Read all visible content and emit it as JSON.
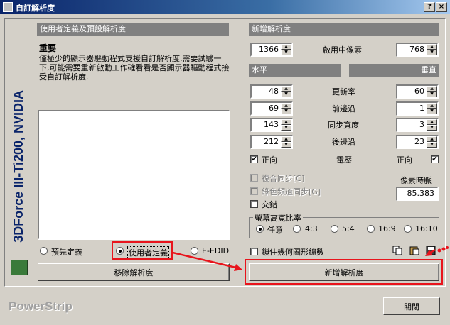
{
  "window": {
    "title": "自訂解析度",
    "help_btn": "?",
    "close_btn": "×"
  },
  "brand": {
    "vertical": "3DForce III-Ti200, NVIDIA",
    "footer": "PowerStrip"
  },
  "left": {
    "header": "使用者定義及預設解析度",
    "heading": "重要",
    "body": "僅極少的顯示器驅動程式支援自訂解析度.需要試驗一下,可能需要重新啟動工作確看看是否顯示器驅動程式接受自訂解析度.",
    "radios": [
      {
        "label": "預先定義",
        "selected": false
      },
      {
        "label": "使用者定義",
        "selected": true
      },
      {
        "label": "E-EDID",
        "selected": false
      }
    ],
    "remove_btn": "移除解析度"
  },
  "right": {
    "header": "新增解析度",
    "h_active": "1366",
    "active_label": "啟用中像素",
    "v_active": "768",
    "horizontal_label": "水平",
    "vertical_label": "垂直",
    "rows": [
      {
        "label": "更新率",
        "h": "48",
        "v": "60"
      },
      {
        "label": "前邊沿",
        "h": "69",
        "v": "1"
      },
      {
        "label": "同步寬度",
        "h": "143",
        "v": "3"
      },
      {
        "label": "後邊沿",
        "h": "212",
        "v": "23"
      }
    ],
    "polarity": {
      "h_label": "正向",
      "mid_label": "電壓",
      "v_label": "正向",
      "h_checked": true,
      "v_checked": true
    },
    "composite_sync": "複合同步[C]",
    "green_sync": "綠色頻道同步[G]",
    "interlace": "交錯",
    "pixel_clock_label": "像素時脈",
    "pixel_clock": "85.383",
    "aspect": {
      "legend": "螢幕高寬比率",
      "options": [
        {
          "label": "任意",
          "selected": true
        },
        {
          "label": "4:3",
          "selected": false
        },
        {
          "label": "5:4",
          "selected": false
        },
        {
          "label": "16:9",
          "selected": false
        },
        {
          "label": "16:10",
          "selected": false
        }
      ]
    },
    "lock_geometry": "鎖住幾何圖形總數",
    "add_btn": "新增解析度"
  },
  "close_btn": "關閉",
  "colors": {
    "annotation": "#e8141c",
    "titlebar": "#0a246a",
    "brand_text": "#0a246a"
  }
}
